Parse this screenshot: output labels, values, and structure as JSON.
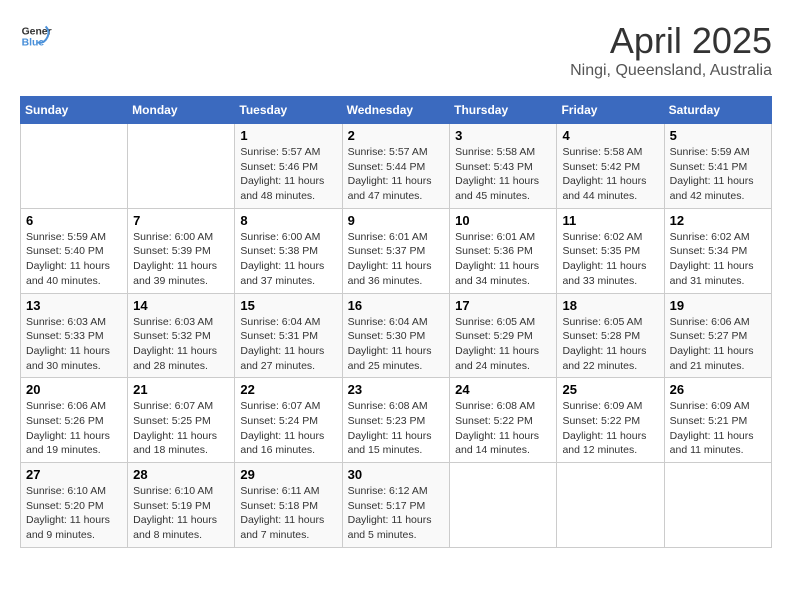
{
  "header": {
    "logo_line1": "General",
    "logo_line2": "Blue",
    "title": "April 2025",
    "subtitle": "Ningi, Queensland, Australia"
  },
  "weekdays": [
    "Sunday",
    "Monday",
    "Tuesday",
    "Wednesday",
    "Thursday",
    "Friday",
    "Saturday"
  ],
  "weeks": [
    [
      {
        "num": "",
        "info": ""
      },
      {
        "num": "",
        "info": ""
      },
      {
        "num": "1",
        "info": "Sunrise: 5:57 AM\nSunset: 5:46 PM\nDaylight: 11 hours and 48 minutes."
      },
      {
        "num": "2",
        "info": "Sunrise: 5:57 AM\nSunset: 5:44 PM\nDaylight: 11 hours and 47 minutes."
      },
      {
        "num": "3",
        "info": "Sunrise: 5:58 AM\nSunset: 5:43 PM\nDaylight: 11 hours and 45 minutes."
      },
      {
        "num": "4",
        "info": "Sunrise: 5:58 AM\nSunset: 5:42 PM\nDaylight: 11 hours and 44 minutes."
      },
      {
        "num": "5",
        "info": "Sunrise: 5:59 AM\nSunset: 5:41 PM\nDaylight: 11 hours and 42 minutes."
      }
    ],
    [
      {
        "num": "6",
        "info": "Sunrise: 5:59 AM\nSunset: 5:40 PM\nDaylight: 11 hours and 40 minutes."
      },
      {
        "num": "7",
        "info": "Sunrise: 6:00 AM\nSunset: 5:39 PM\nDaylight: 11 hours and 39 minutes."
      },
      {
        "num": "8",
        "info": "Sunrise: 6:00 AM\nSunset: 5:38 PM\nDaylight: 11 hours and 37 minutes."
      },
      {
        "num": "9",
        "info": "Sunrise: 6:01 AM\nSunset: 5:37 PM\nDaylight: 11 hours and 36 minutes."
      },
      {
        "num": "10",
        "info": "Sunrise: 6:01 AM\nSunset: 5:36 PM\nDaylight: 11 hours and 34 minutes."
      },
      {
        "num": "11",
        "info": "Sunrise: 6:02 AM\nSunset: 5:35 PM\nDaylight: 11 hours and 33 minutes."
      },
      {
        "num": "12",
        "info": "Sunrise: 6:02 AM\nSunset: 5:34 PM\nDaylight: 11 hours and 31 minutes."
      }
    ],
    [
      {
        "num": "13",
        "info": "Sunrise: 6:03 AM\nSunset: 5:33 PM\nDaylight: 11 hours and 30 minutes."
      },
      {
        "num": "14",
        "info": "Sunrise: 6:03 AM\nSunset: 5:32 PM\nDaylight: 11 hours and 28 minutes."
      },
      {
        "num": "15",
        "info": "Sunrise: 6:04 AM\nSunset: 5:31 PM\nDaylight: 11 hours and 27 minutes."
      },
      {
        "num": "16",
        "info": "Sunrise: 6:04 AM\nSunset: 5:30 PM\nDaylight: 11 hours and 25 minutes."
      },
      {
        "num": "17",
        "info": "Sunrise: 6:05 AM\nSunset: 5:29 PM\nDaylight: 11 hours and 24 minutes."
      },
      {
        "num": "18",
        "info": "Sunrise: 6:05 AM\nSunset: 5:28 PM\nDaylight: 11 hours and 22 minutes."
      },
      {
        "num": "19",
        "info": "Sunrise: 6:06 AM\nSunset: 5:27 PM\nDaylight: 11 hours and 21 minutes."
      }
    ],
    [
      {
        "num": "20",
        "info": "Sunrise: 6:06 AM\nSunset: 5:26 PM\nDaylight: 11 hours and 19 minutes."
      },
      {
        "num": "21",
        "info": "Sunrise: 6:07 AM\nSunset: 5:25 PM\nDaylight: 11 hours and 18 minutes."
      },
      {
        "num": "22",
        "info": "Sunrise: 6:07 AM\nSunset: 5:24 PM\nDaylight: 11 hours and 16 minutes."
      },
      {
        "num": "23",
        "info": "Sunrise: 6:08 AM\nSunset: 5:23 PM\nDaylight: 11 hours and 15 minutes."
      },
      {
        "num": "24",
        "info": "Sunrise: 6:08 AM\nSunset: 5:22 PM\nDaylight: 11 hours and 14 minutes."
      },
      {
        "num": "25",
        "info": "Sunrise: 6:09 AM\nSunset: 5:22 PM\nDaylight: 11 hours and 12 minutes."
      },
      {
        "num": "26",
        "info": "Sunrise: 6:09 AM\nSunset: 5:21 PM\nDaylight: 11 hours and 11 minutes."
      }
    ],
    [
      {
        "num": "27",
        "info": "Sunrise: 6:10 AM\nSunset: 5:20 PM\nDaylight: 11 hours and 9 minutes."
      },
      {
        "num": "28",
        "info": "Sunrise: 6:10 AM\nSunset: 5:19 PM\nDaylight: 11 hours and 8 minutes."
      },
      {
        "num": "29",
        "info": "Sunrise: 6:11 AM\nSunset: 5:18 PM\nDaylight: 11 hours and 7 minutes."
      },
      {
        "num": "30",
        "info": "Sunrise: 6:12 AM\nSunset: 5:17 PM\nDaylight: 11 hours and 5 minutes."
      },
      {
        "num": "",
        "info": ""
      },
      {
        "num": "",
        "info": ""
      },
      {
        "num": "",
        "info": ""
      }
    ]
  ]
}
